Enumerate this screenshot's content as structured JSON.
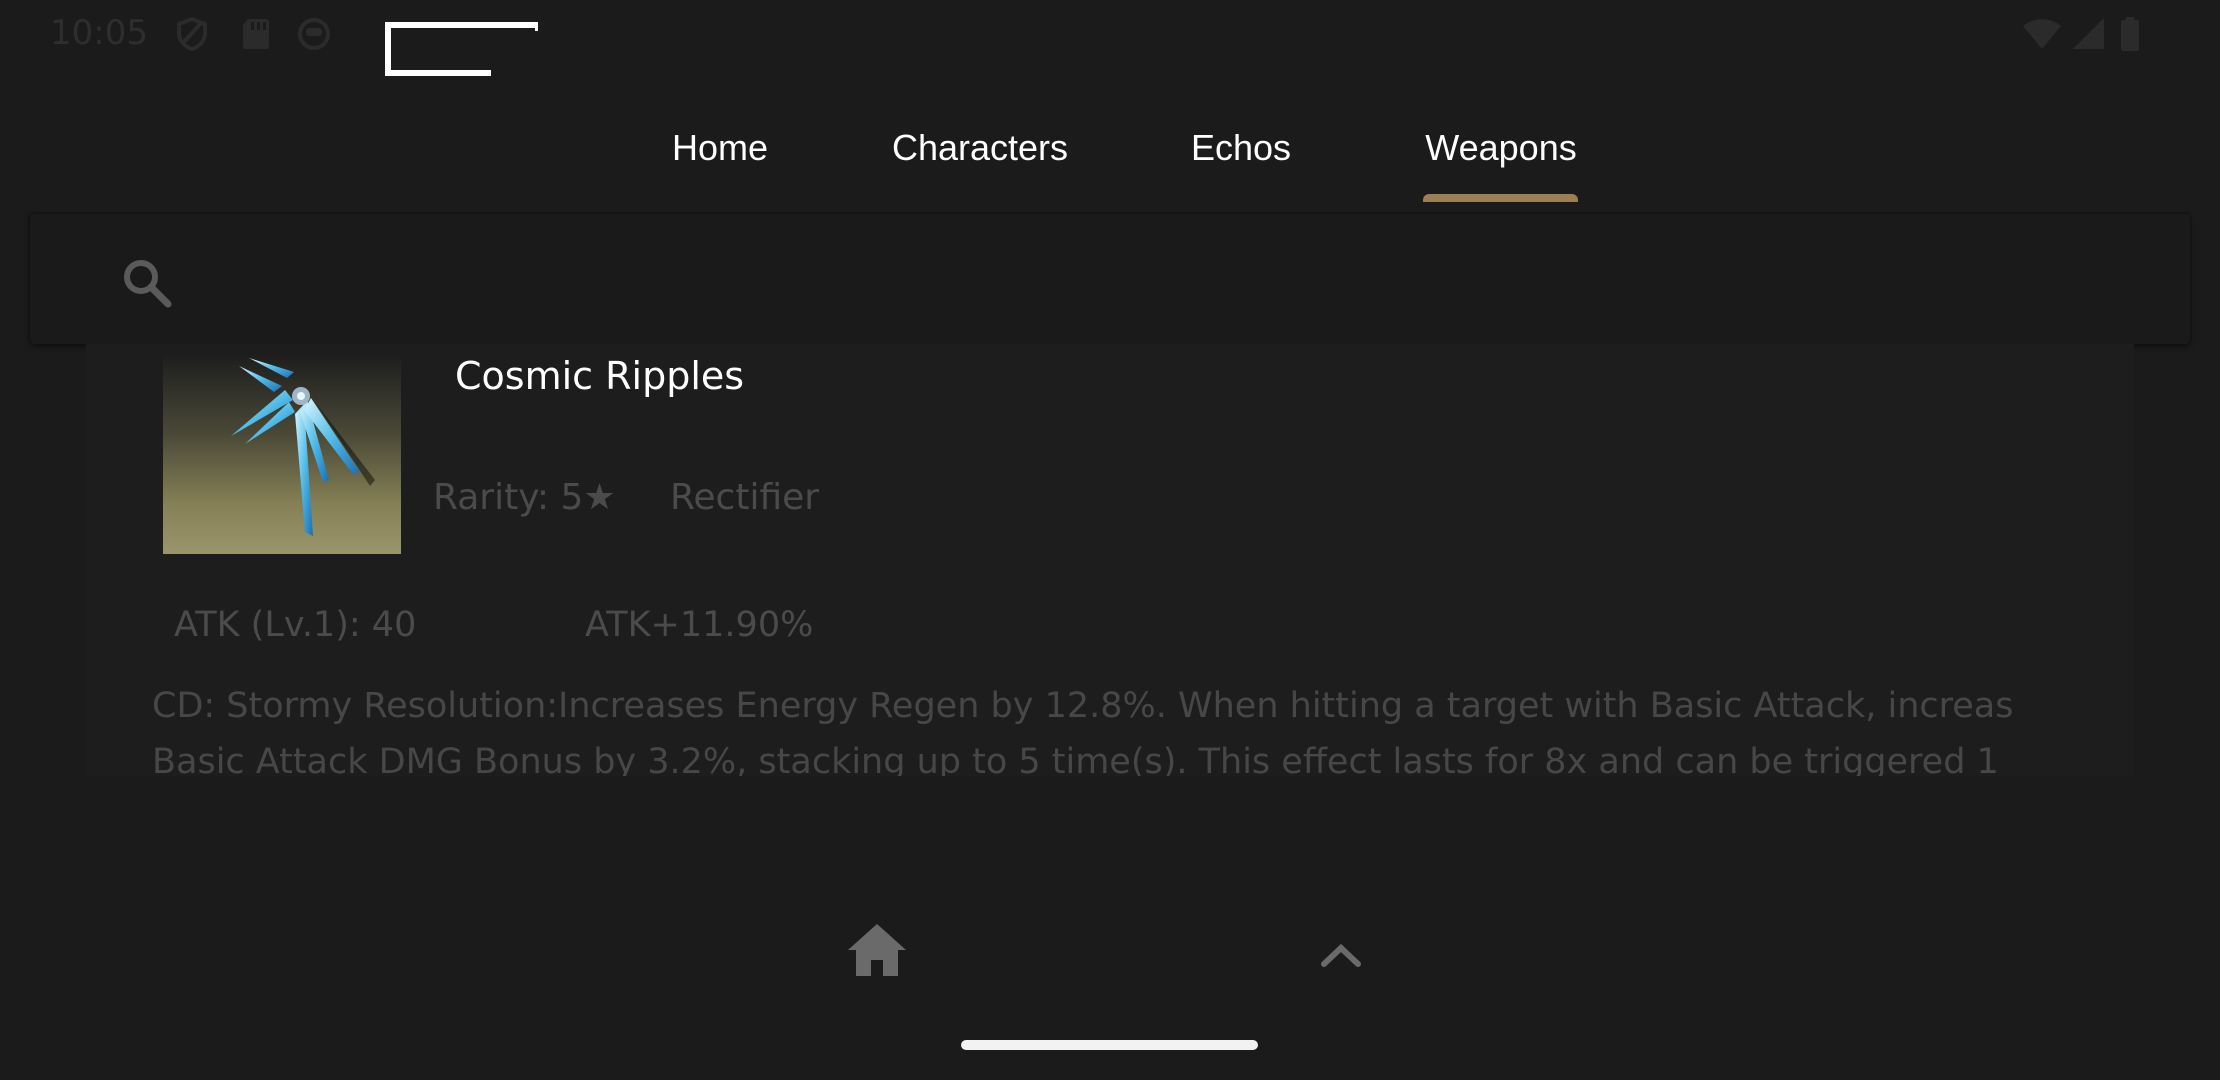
{
  "status_bar": {
    "time": "10:05",
    "left_icons": [
      "shield-icon",
      "sd-card-icon",
      "app-badge-icon"
    ],
    "right_icons": [
      "wifi-icon",
      "cellular-signal-icon",
      "battery-icon"
    ]
  },
  "tabs": [
    {
      "label": "Home",
      "selected": false
    },
    {
      "label": "Characters",
      "selected": false
    },
    {
      "label": "Echos",
      "selected": false
    },
    {
      "label": "Weapons",
      "selected": true
    }
  ],
  "search": {
    "icon": "search-icon",
    "value": "",
    "placeholder": ""
  },
  "weapon": {
    "name": "Cosmic Ripples",
    "rarity": "Rarity: 5★",
    "type": "Rectifier",
    "atk": "ATK (Lv.1): 40",
    "secondary_stat": "ATK+11.90%",
    "skill_line1": "CD: Stormy Resolution:Increases Energy Regen by 12.8%. When hitting a target with Basic Attack, increas",
    "skill_line2": "Basic Attack DMG Bonus by 3.2%, stacking up to 5 time(s). This effect lasts for 8x and can be triggered 1"
  },
  "bottom_nav": {
    "home_icon": "home-icon",
    "scroll_top_icon": "chevron-up-icon"
  },
  "colors": {
    "background": "#1b1b1b",
    "tab_indicator": "#9c7f52",
    "primary_text": "#ffffff",
    "muted_text": "#4b4b4b"
  }
}
